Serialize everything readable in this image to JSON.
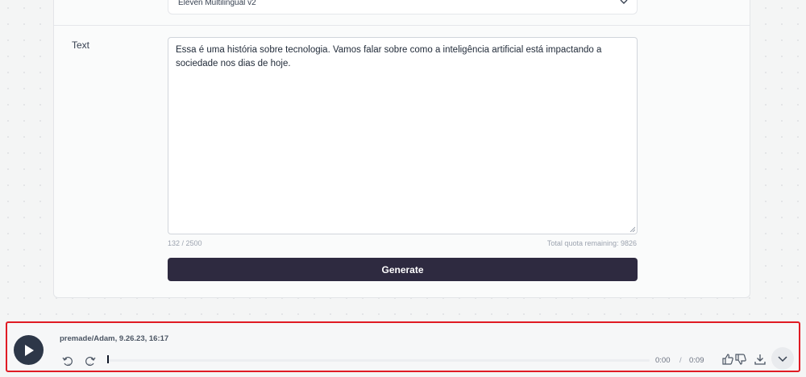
{
  "form": {
    "model_selected": "Eleven Multilingual v2",
    "text_label": "Text",
    "text_value": "Essa é uma história sobre tecnologia. Vamos falar sobre como a inteligência artificial está impactando a sociedade nos dias de hoje.",
    "char_counter": "132 / 2500",
    "quota": "Total quota remaining: 9826",
    "generate_label": "Generate"
  },
  "player": {
    "track_title": "premade/Adam, 9.26.23, 16:17",
    "current_time": "0:00",
    "separator": "/",
    "duration": "0:09",
    "progress_fraction": 0.0,
    "icons": [
      "play-icon",
      "rewind-10-icon",
      "forward-10-icon",
      "thumbs-up-icon",
      "thumbs-down-icon",
      "download-icon",
      "chevron-down-icon"
    ]
  },
  "colors": {
    "accent": "#2e2a40",
    "highlight_border": "#e01b24",
    "play_button": "#2d3748"
  }
}
